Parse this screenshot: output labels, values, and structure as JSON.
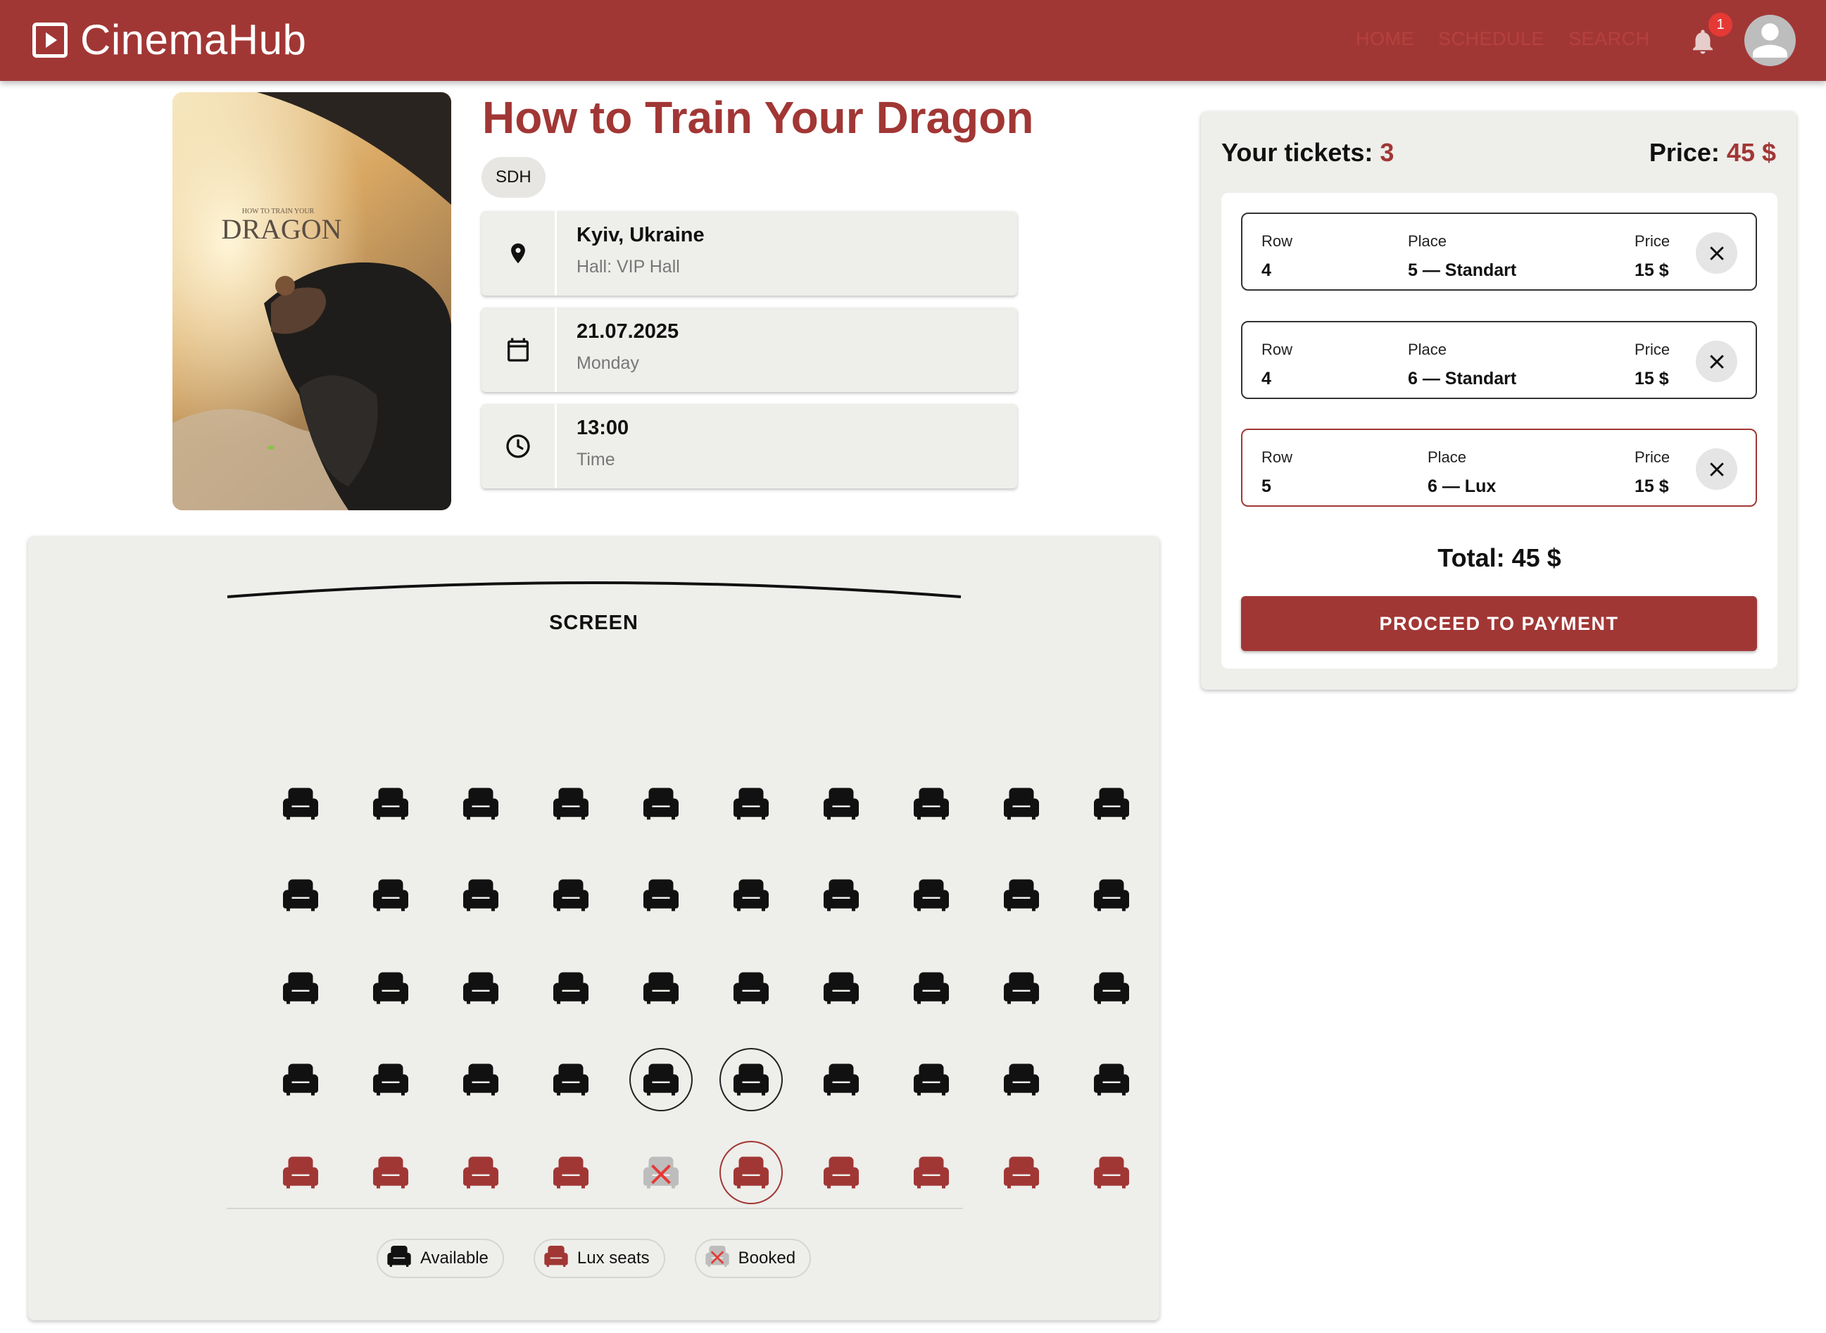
{
  "app": {
    "title": "CinemaHub"
  },
  "nav": {
    "items": [
      "HOME",
      "SCHEDULE",
      "SEARCH"
    ],
    "notification_count": "1"
  },
  "movie": {
    "title": "How to Train Your Dragon",
    "poster_text": "DRAGON",
    "poster_subtext": "HOW TO TRAIN YOUR",
    "subtitle_chip": "SDH",
    "location": "Kyiv, Ukraine",
    "hall": "Hall: VIP Hall",
    "date": "21.07.2025",
    "weekday": "Monday",
    "time": "13:00",
    "time_label": "Time"
  },
  "hall": {
    "screen_label": "SCREEN",
    "rows": [
      [
        "available",
        "available",
        "available",
        "available",
        "available",
        "available",
        "available",
        "available",
        "available",
        "available"
      ],
      [
        "available",
        "available",
        "available",
        "available",
        "available",
        "available",
        "available",
        "available",
        "available",
        "available"
      ],
      [
        "available",
        "available",
        "available",
        "available",
        "available",
        "available",
        "available",
        "available",
        "available",
        "available"
      ],
      [
        "available",
        "available",
        "available",
        "available",
        "selected",
        "selected",
        "available",
        "available",
        "available",
        "available"
      ],
      [
        "lux",
        "lux",
        "lux",
        "lux",
        "booked",
        "lux-selected",
        "lux",
        "lux",
        "lux",
        "lux"
      ]
    ],
    "legend": {
      "available": "Available",
      "lux": "Lux seats",
      "booked": "Booked"
    }
  },
  "tickets": {
    "count_label": "Your tickets:",
    "count": "3",
    "price_label": "Price:",
    "price": "45 $",
    "column_labels": {
      "row": "Row",
      "place": "Place",
      "price": "Price"
    },
    "items": [
      {
        "row": "4",
        "place": "5 — Standart",
        "price": "15 $",
        "type": "standart"
      },
      {
        "row": "4",
        "place": "6 — Standart",
        "price": "15 $",
        "type": "standart"
      },
      {
        "row": "5",
        "place": "6 — Lux",
        "price": "15 $",
        "type": "lux"
      }
    ],
    "total": "Total: 45 $",
    "pay_button": "PROCEED TO PAYMENT"
  },
  "colors": {
    "brand": "#a13735",
    "panel": "#eeeeeb",
    "lux": "#a13735",
    "booked": "#bdbdbd"
  }
}
